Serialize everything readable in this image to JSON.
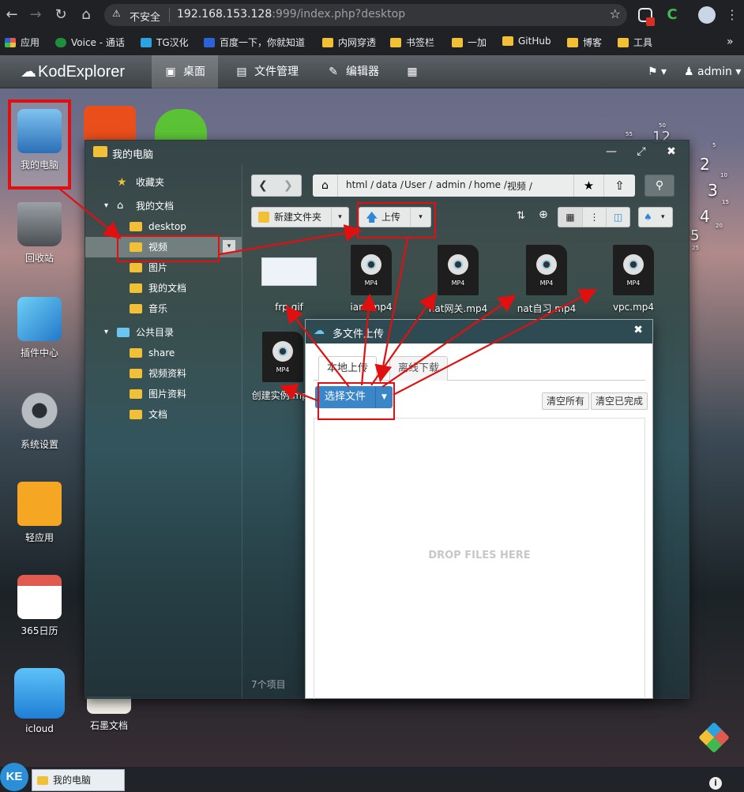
{
  "browser": {
    "security_label": "不安全",
    "url_host": "192.168.153.128",
    "url_rest": ":999/index.php?desktop",
    "bookmarks": [
      {
        "label": "应用",
        "color": "#e05a4f"
      },
      {
        "label": "Voice - 通话",
        "color": "#1e8e3e"
      },
      {
        "label": "TG汉化",
        "color": "#2aa3e0"
      },
      {
        "label": "百度一下，你就知道",
        "color": "#2c63d6"
      },
      {
        "label": "内网穿透",
        "color": "#f2c037"
      },
      {
        "label": "书签栏",
        "color": "#f2c037"
      },
      {
        "label": "一加",
        "color": "#f2c037"
      },
      {
        "label": "GitHub",
        "color": "#f2c037"
      },
      {
        "label": "博客",
        "color": "#f2c037"
      },
      {
        "label": "工具",
        "color": "#f2c037"
      }
    ]
  },
  "app": {
    "logo": "KodExplorer",
    "tabs": [
      {
        "label": "桌面",
        "icon": "monitor-icon",
        "active": true
      },
      {
        "label": "文件管理",
        "icon": "drive-icon",
        "active": false
      },
      {
        "label": "编辑器",
        "icon": "edit-icon",
        "active": false
      }
    ],
    "user": "admin"
  },
  "desktop_icons": [
    {
      "label": "我的电脑",
      "icon": "computer-icon",
      "color": "#3d8fd8"
    },
    {
      "label": "回收站",
      "icon": "trash-icon",
      "color": "#6d7378"
    },
    {
      "label": "插件中心",
      "icon": "plugin-icon",
      "color": "#3a9ad9"
    },
    {
      "label": "系统设置",
      "icon": "gear-icon",
      "color": "#9aa1a8"
    },
    {
      "label": "轻应用",
      "icon": "shopping-bag-icon",
      "color": "#f5a623"
    },
    {
      "label": "365日历",
      "icon": "calendar-icon",
      "color": "#ffffff"
    },
    {
      "label": "icloud",
      "icon": "cloud-icon",
      "color": "#2d9be8"
    },
    {
      "label": "石墨文档",
      "icon": "document-icon",
      "color": "#f0ede6"
    }
  ],
  "explorer": {
    "title": "我的电脑",
    "tree": {
      "favorites": "收藏夹",
      "my_docs": "我的文档",
      "children": [
        "desktop",
        "视频",
        "图片",
        "我的文档",
        "音乐"
      ],
      "public": "公共目录",
      "public_children": [
        "share",
        "视频资料",
        "图片资料",
        "文档"
      ]
    },
    "path": [
      "html",
      "data",
      "User",
      "admin",
      "home",
      "视频"
    ],
    "new_folder": "新建文件夹",
    "upload": "上传",
    "files": [
      "frp.gif",
      "iam.mp4",
      "nat网关.mp4",
      "nat自习.mp4",
      "vpc.mp4",
      "创建实例.mp4"
    ],
    "file_type_label": "MP4",
    "status": "7个项目"
  },
  "upload_dialog": {
    "title": "多文件上传",
    "tabs": [
      "本地上传",
      "离线下载"
    ],
    "choose_files": "选择文件",
    "clear_all": "清空所有",
    "clear_done": "清空已完成",
    "drop_text": "DROP FILES HERE"
  },
  "clock": {
    "numbers": [
      "12",
      "2",
      "3",
      "4",
      "5"
    ],
    "small": [
      "55",
      "50",
      "5",
      "10",
      "15",
      "20",
      "25"
    ]
  },
  "taskbar": {
    "logo": "KE",
    "item": "我的电脑"
  }
}
